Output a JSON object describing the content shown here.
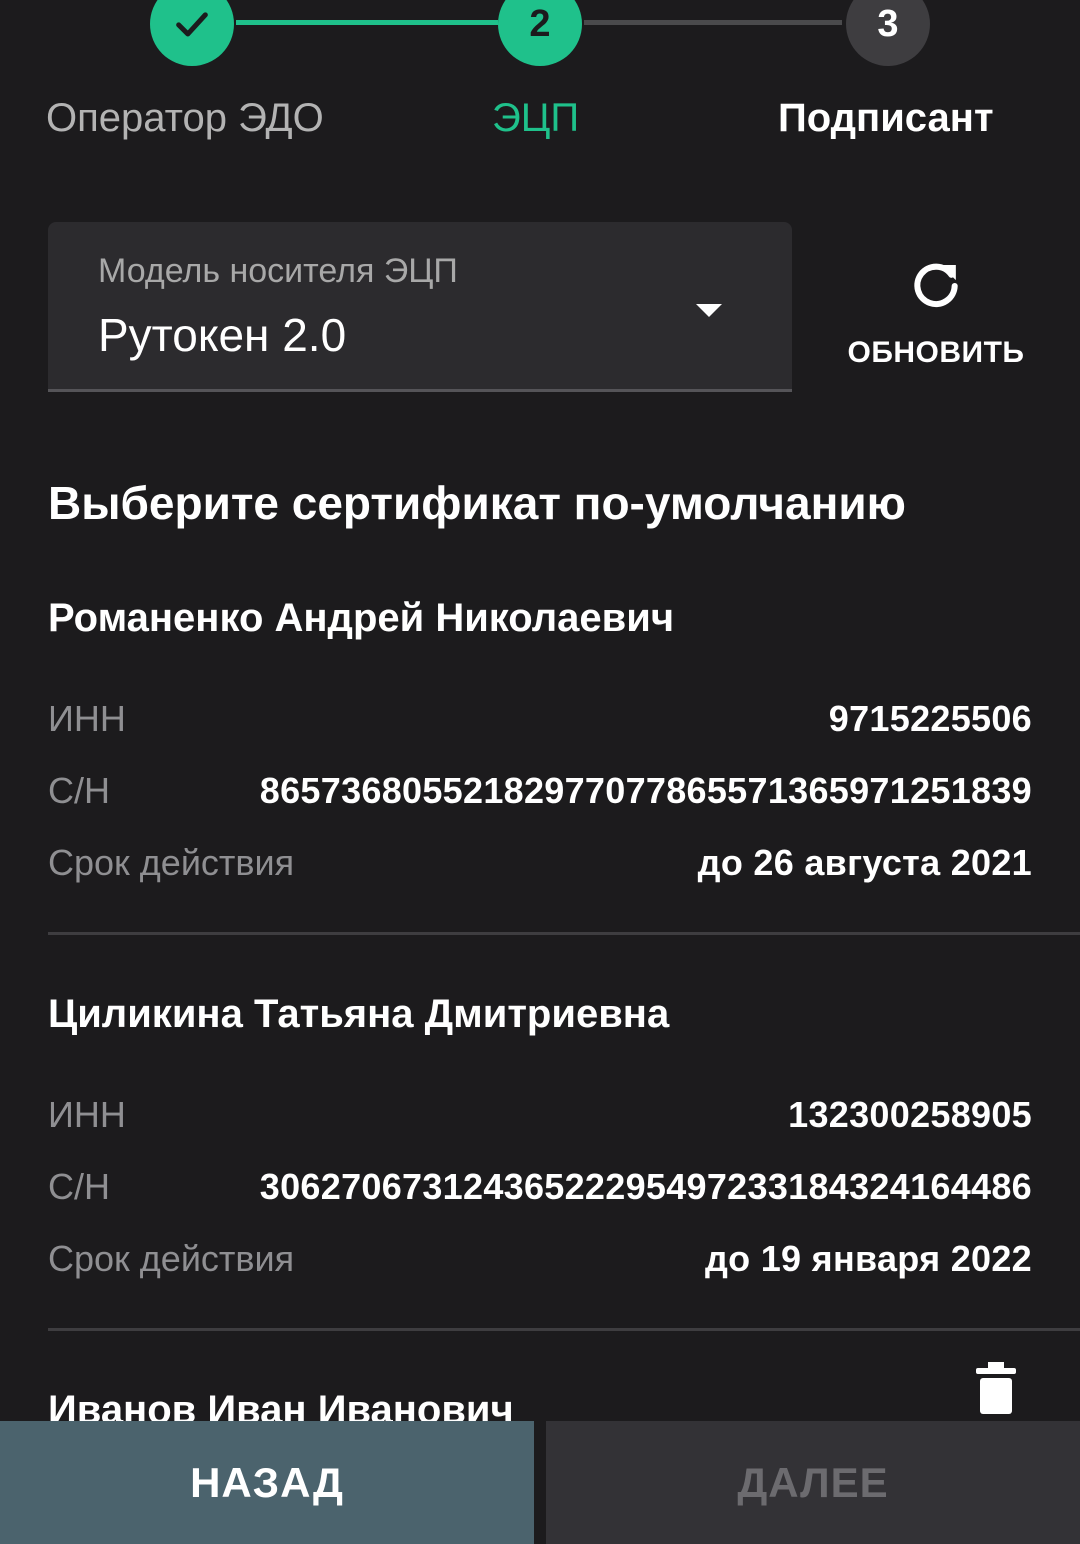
{
  "stepper": {
    "steps": [
      {
        "number": "",
        "label": "Оператор ЭДО",
        "state": "done"
      },
      {
        "number": "2",
        "label": "ЭЦП",
        "state": "current"
      },
      {
        "number": "3",
        "label": "Подписант",
        "state": "todo"
      }
    ],
    "accent_color": "#1fc18b"
  },
  "carrier_select": {
    "label": "Модель носителя ЭЦП",
    "value": "Рутокен 2.0"
  },
  "refresh": {
    "label": "ОБНОВИТЬ"
  },
  "section_title": "Выберите сертификат по-умолчанию",
  "certificates": [
    {
      "name": "Романенко Андрей Николаевич",
      "inn_label": "ИНН",
      "inn": "9715225506",
      "sn_label": "С/Н",
      "sn": "865736805521829770778655713659712518​39",
      "validity_label": "Срок действия",
      "validity": "до 26 августа 2021"
    },
    {
      "name": "Циликина Татьяна Дмитриевна",
      "inn_label": "ИНН",
      "inn": "132300258905",
      "sn_label": "С/Н",
      "sn": "306270673124365222954972331843241644​86",
      "validity_label": "Срок действия",
      "validity": "до 19 января 2022"
    },
    {
      "name": "Иванов Иван Иванович"
    }
  ],
  "buttons": {
    "back": "НАЗАД",
    "next": "ДАЛЕЕ"
  }
}
